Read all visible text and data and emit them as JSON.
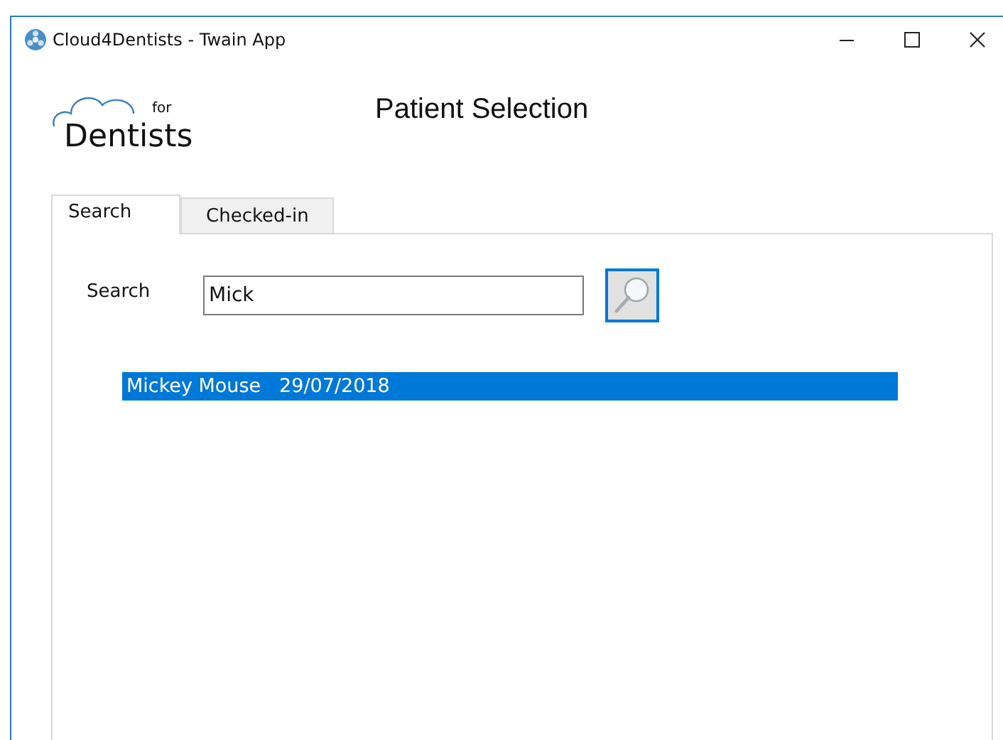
{
  "window": {
    "title": "Cloud4Dentists - Twain App"
  },
  "logo": {
    "superscript": "for",
    "wordmark": "Dentists"
  },
  "heading": "Patient Selection",
  "tabs": [
    {
      "label": "Search",
      "selected": true
    },
    {
      "label": "Checked-in",
      "selected": false
    }
  ],
  "search": {
    "label": "Search",
    "value": "Mick"
  },
  "results": [
    {
      "name": "Mickey Mouse",
      "date": "29/07/2018",
      "selected": true
    }
  ]
}
